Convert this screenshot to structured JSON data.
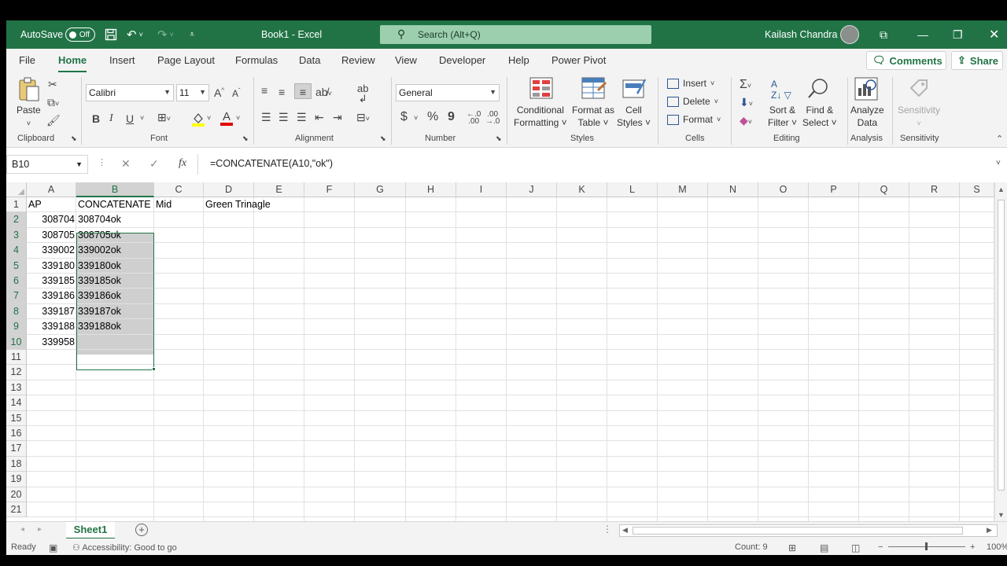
{
  "titlebar": {
    "autosave_label": "AutoSave",
    "autosave_state": "Off",
    "book_title": "Book1  -  Excel",
    "search_placeholder": "Search (Alt+Q)",
    "user_name": "Kailash Chandra"
  },
  "menu": {
    "tabs": [
      "File",
      "Home",
      "Insert",
      "Page Layout",
      "Formulas",
      "Data",
      "Review",
      "View",
      "Developer",
      "Help",
      "Power Pivot"
    ],
    "active_tab": "Home",
    "comments_label": "Comments",
    "share_label": "Share"
  },
  "ribbon": {
    "clipboard": {
      "label": "Clipboard",
      "paste": "Paste"
    },
    "font": {
      "label": "Font",
      "font_name": "Calibri",
      "font_size": "11",
      "bold": "B",
      "italic": "I",
      "underline": "U"
    },
    "alignment": {
      "label": "Alignment"
    },
    "number": {
      "label": "Number",
      "format": "General",
      "currency": "$",
      "percent": "%",
      "comma": "9"
    },
    "styles": {
      "label": "Styles",
      "conditional": [
        "Conditional",
        "Formatting ˅"
      ],
      "format_table": [
        "Format as",
        "Table ˅"
      ],
      "cell_styles": [
        "Cell",
        "Styles ˅"
      ]
    },
    "cells": {
      "label": "Cells",
      "insert": "Insert",
      "delete": "Delete",
      "format": "Format"
    },
    "editing": {
      "label": "Editing",
      "sort": [
        "Sort &",
        "Filter ˅"
      ],
      "find": [
        "Find &",
        "Select ˅"
      ]
    },
    "analysis": {
      "label": "Analysis",
      "analyze": [
        "Analyze",
        "Data"
      ]
    },
    "sensitivity": {
      "label": "Sensitivity",
      "button": "Sensitivity"
    }
  },
  "formula_bar": {
    "name_box": "B10",
    "formula": "=CONCATENATE(A10,\"ok\")"
  },
  "grid": {
    "columns": [
      "A",
      "B",
      "C",
      "D",
      "E",
      "F",
      "G",
      "H",
      "I",
      "J",
      "K",
      "L",
      "M",
      "N",
      "O",
      "P",
      "Q",
      "R",
      "S"
    ],
    "rows": [
      "1",
      "2",
      "3",
      "4",
      "5",
      "6",
      "7",
      "8",
      "9",
      "10",
      "11",
      "12",
      "13",
      "14",
      "15",
      "16",
      "17",
      "18",
      "19",
      "20",
      "21"
    ],
    "selected_column": "B",
    "selected_rows": [
      "2",
      "3",
      "4",
      "5",
      "6",
      "7",
      "8",
      "9",
      "10"
    ],
    "cells": {
      "A1": "AP",
      "B1": "CONCATENATE",
      "C1": "Mid",
      "D1": "Green Trinagle",
      "A2": "308704",
      "B2": "308704ok",
      "A3": "308705",
      "B3": "308705ok",
      "A4": "339002",
      "B4": "339002ok",
      "A5": "339180",
      "B5": "339180ok",
      "A6": "339185",
      "B6": "339185ok",
      "A7": "339186",
      "B7": "339186ok",
      "A8": "339187",
      "B8": "339187ok",
      "A9": "339188",
      "B9": "339188ok",
      "A10": "339958"
    }
  },
  "sheets": {
    "tabs": [
      "Sheet1"
    ],
    "active": "Sheet1",
    "add_icon": "+"
  },
  "statusbar": {
    "ready": "Ready",
    "accessibility": "Accessibility: Good to go",
    "count": "Count: 9",
    "zoom": "100%"
  }
}
